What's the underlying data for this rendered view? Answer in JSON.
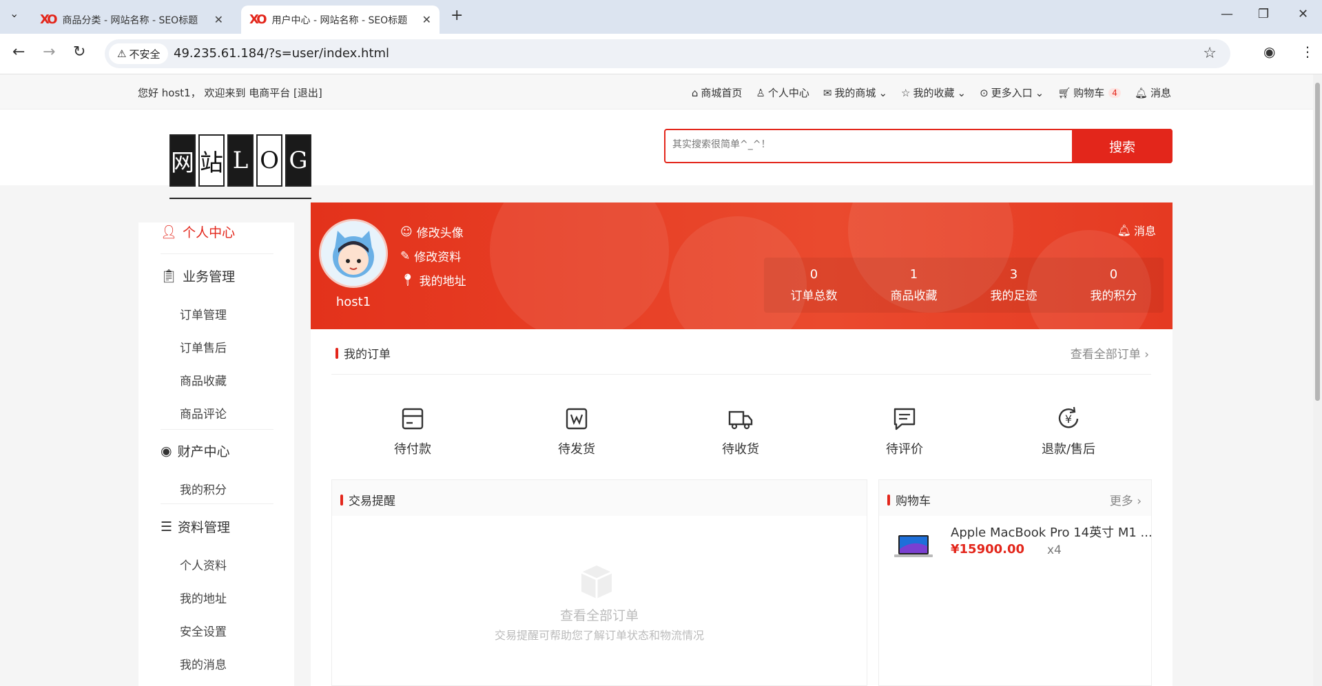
{
  "browser": {
    "tabs": [
      {
        "title": "商品分类 - 网站名称 - SEO标题",
        "active": false
      },
      {
        "title": "用户中心 - 网站名称 - SEO标题",
        "active": true
      }
    ],
    "security_label": "不安全",
    "url": "49.235.61.184/?s=user/index.html"
  },
  "topbar": {
    "welcome": "您好 host1， 欢迎来到 电商平台 [退出]",
    "nav": [
      {
        "icon": "home-icon",
        "label": "商城首页"
      },
      {
        "icon": "user-icon",
        "label": "个人中心"
      },
      {
        "icon": "mail-icon",
        "label": "我的商城"
      },
      {
        "icon": "star-icon",
        "label": "我的收藏"
      },
      {
        "icon": "more-icon",
        "label": "更多入口"
      },
      {
        "icon": "cart-icon",
        "label": "购物车",
        "badge": "4"
      },
      {
        "icon": "bell-icon",
        "label": "消息"
      }
    ]
  },
  "header": {
    "logo_chars": [
      "网",
      "站",
      "L",
      "O",
      "G"
    ],
    "search_placeholder": "其实搜索很简单^_^！",
    "search_button": "搜索"
  },
  "sidebar": {
    "groups": [
      {
        "label": "个人中心",
        "icon": "user-icon",
        "items": []
      },
      {
        "label": "业务管理",
        "icon": "clipboard-icon",
        "items": [
          "订单管理",
          "订单售后",
          "商品收藏",
          "商品评论"
        ]
      },
      {
        "label": "财产中心",
        "icon": "coin-icon",
        "items": [
          "我的积分"
        ]
      },
      {
        "label": "资料管理",
        "icon": "list-icon",
        "items": [
          "个人资料",
          "我的地址",
          "安全设置",
          "我的消息"
        ]
      }
    ]
  },
  "banner": {
    "username": "host1",
    "links": [
      "修改头像",
      "修改资料",
      "我的地址"
    ],
    "message": "消息",
    "stats": [
      {
        "value": "0",
        "label": "订单总数"
      },
      {
        "value": "1",
        "label": "商品收藏"
      },
      {
        "value": "3",
        "label": "我的足迹"
      },
      {
        "value": "0",
        "label": "我的积分"
      }
    ]
  },
  "orders": {
    "title": "我的订单",
    "more": "查看全部订单",
    "statuses": [
      {
        "label": "待付款",
        "icon": "wallet-icon"
      },
      {
        "label": "待发货",
        "icon": "package-icon"
      },
      {
        "label": "待收货",
        "icon": "truck-icon"
      },
      {
        "label": "待评价",
        "icon": "comment-icon"
      },
      {
        "label": "退款/售后",
        "icon": "refund-icon"
      }
    ]
  },
  "trade": {
    "title": "交易提醒",
    "empty_title": "查看全部订单",
    "empty_desc": "交易提醒可帮助您了解订单状态和物流情况"
  },
  "cart": {
    "title": "购物车",
    "more": "更多",
    "items": [
      {
        "name": "Apple MacBook Pro 14英寸 M1 ...",
        "price": "¥15900.00",
        "qty": "x4"
      }
    ]
  },
  "colors": {
    "accent": "#e3261b"
  }
}
